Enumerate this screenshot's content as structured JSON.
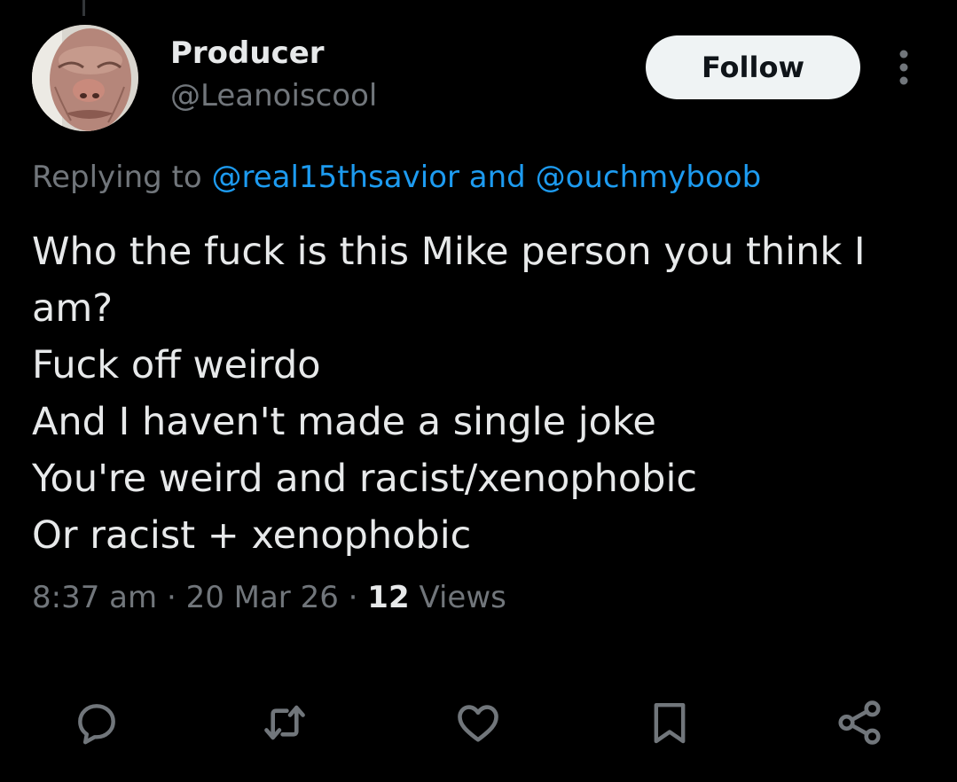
{
  "author": {
    "display_name": "Producer",
    "handle": "@Leanoiscool",
    "avatar_icon": "profile-photo"
  },
  "follow_label": "Follow",
  "reply_context": {
    "prefix": "Replying to",
    "mention_1": "@real15thsavior",
    "conjunction": "and",
    "mention_2": "@ouchmyboob"
  },
  "tweet_lines": [
    "Who the fuck is this Mike person you think I",
    "am?",
    "Fuck off weirdo",
    "And I haven't made a single joke",
    "You're weird and racist/xenophobic",
    "Or racist + xenophobic"
  ],
  "meta": {
    "time": "8:37 am",
    "separator": "·",
    "date": "20 Mar 26",
    "views_count": "12",
    "views_label": "Views"
  },
  "actions": [
    "reply-icon",
    "retweet-icon",
    "like-icon",
    "bookmark-icon",
    "share-icon"
  ],
  "colors": {
    "background": "#000000",
    "text": "#e7e9ea",
    "muted": "#71767b",
    "link": "#1d9bf0",
    "button_bg": "#eff3f4"
  }
}
